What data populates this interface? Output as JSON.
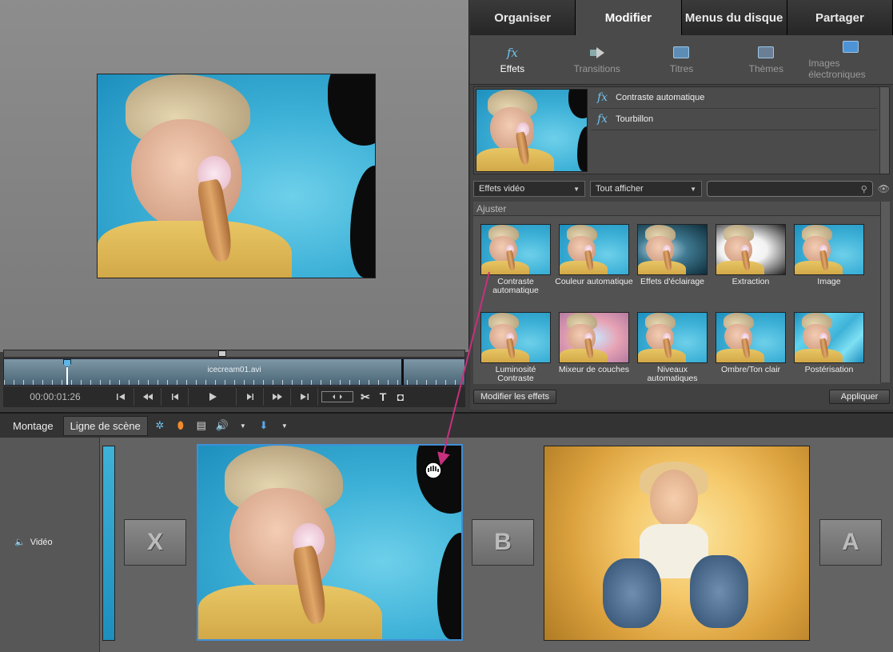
{
  "tabs": [
    {
      "label": "Organiser"
    },
    {
      "label": "Modifier"
    },
    {
      "label": "Menus du disque"
    },
    {
      "label": "Partager"
    }
  ],
  "subtabs": [
    {
      "label": "Effets",
      "icon": "fx-icon"
    },
    {
      "label": "Transitions",
      "icon": "transition-icon"
    },
    {
      "label": "Titres",
      "icon": "titles-icon"
    },
    {
      "label": "Thèmes",
      "icon": "themes-icon"
    },
    {
      "label": "Images électroniques",
      "icon": "clipart-icon"
    }
  ],
  "applied_effects": [
    {
      "label": "Contraste automatique"
    },
    {
      "label": "Tourbillon"
    }
  ],
  "filters": {
    "category": "Effets vidéo",
    "show": "Tout afficher",
    "search_placeholder": ""
  },
  "section": "Ajuster",
  "effects": [
    {
      "label": "Contraste automatique",
      "style": "normal"
    },
    {
      "label": "Couleur automatique",
      "style": "normal"
    },
    {
      "label": "Effets d'éclairage",
      "style": "dark"
    },
    {
      "label": "Extraction",
      "style": "bw"
    },
    {
      "label": "Image",
      "style": "normal"
    },
    {
      "label": "Luminosité Contraste",
      "style": "normal"
    },
    {
      "label": "Mixeur de couches",
      "style": "pink"
    },
    {
      "label": "Niveaux automatiques",
      "style": "normal"
    },
    {
      "label": "Ombre/Ton clair",
      "style": "normal"
    },
    {
      "label": "Postérisation",
      "style": "poster"
    }
  ],
  "panel_buttons": {
    "edit": "Modifier les effets",
    "apply": "Appliquer"
  },
  "monitor": {
    "clip_name": "icecream01.avi",
    "timecode": "00:00:01:26"
  },
  "scene": {
    "tabs": [
      {
        "label": "Montage"
      },
      {
        "label": "Ligne de scène"
      }
    ],
    "track_label": "Vidéo"
  },
  "colors": {
    "accent": "#6fc3ef",
    "drag_arrow": "#c8307e",
    "selected_clip_border": "#3f8fd6"
  }
}
